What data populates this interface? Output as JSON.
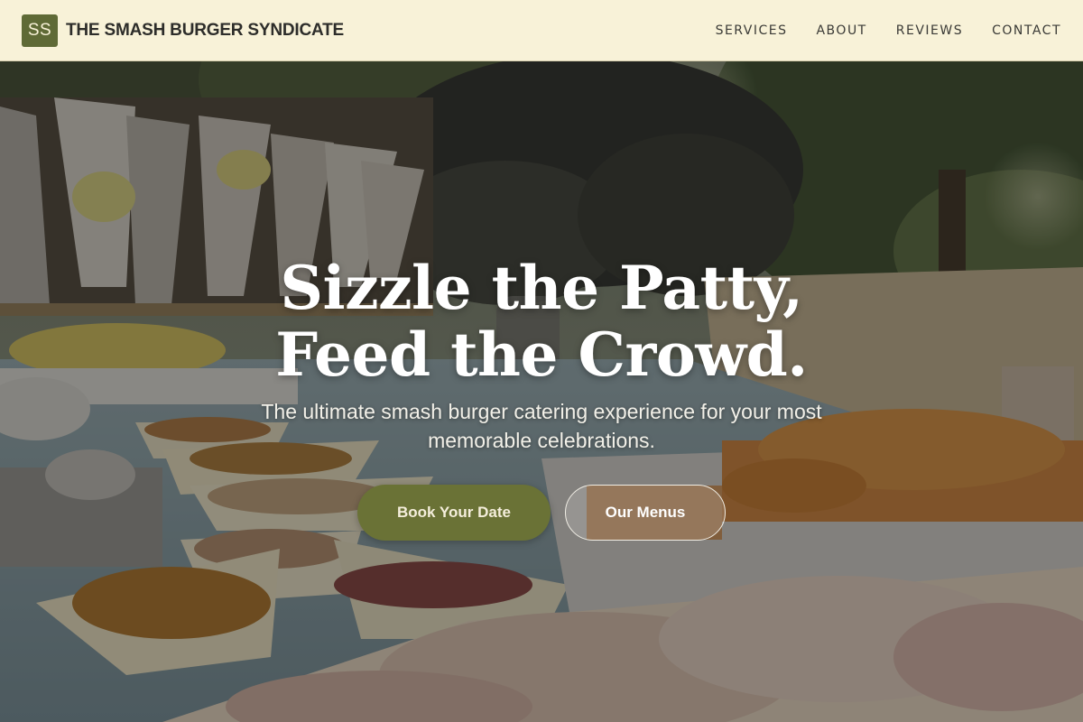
{
  "header": {
    "logo_initials": "SS",
    "brand_name": "THE SMASH BURGER SYNDICATE",
    "nav": [
      {
        "label": "SERVICES"
      },
      {
        "label": "ABOUT"
      },
      {
        "label": "REVIEWS"
      },
      {
        "label": "CONTACT"
      }
    ]
  },
  "hero": {
    "title_line1": "Sizzle the Patty,",
    "title_line2": "Feed the Crowd.",
    "subtitle": "The ultimate smash burger catering experience for your most memorable celebrations.",
    "primary_button": "Book Your Date",
    "secondary_button": "Our Menus",
    "background_image": "outdoor catering buffet table with snacks, chips cones and sandwiches"
  },
  "colors": {
    "header_bg": "#f8f2d8",
    "brand_accent": "#5f6a36",
    "primary_button": "#6a7236",
    "text_light": "#ffffff"
  }
}
